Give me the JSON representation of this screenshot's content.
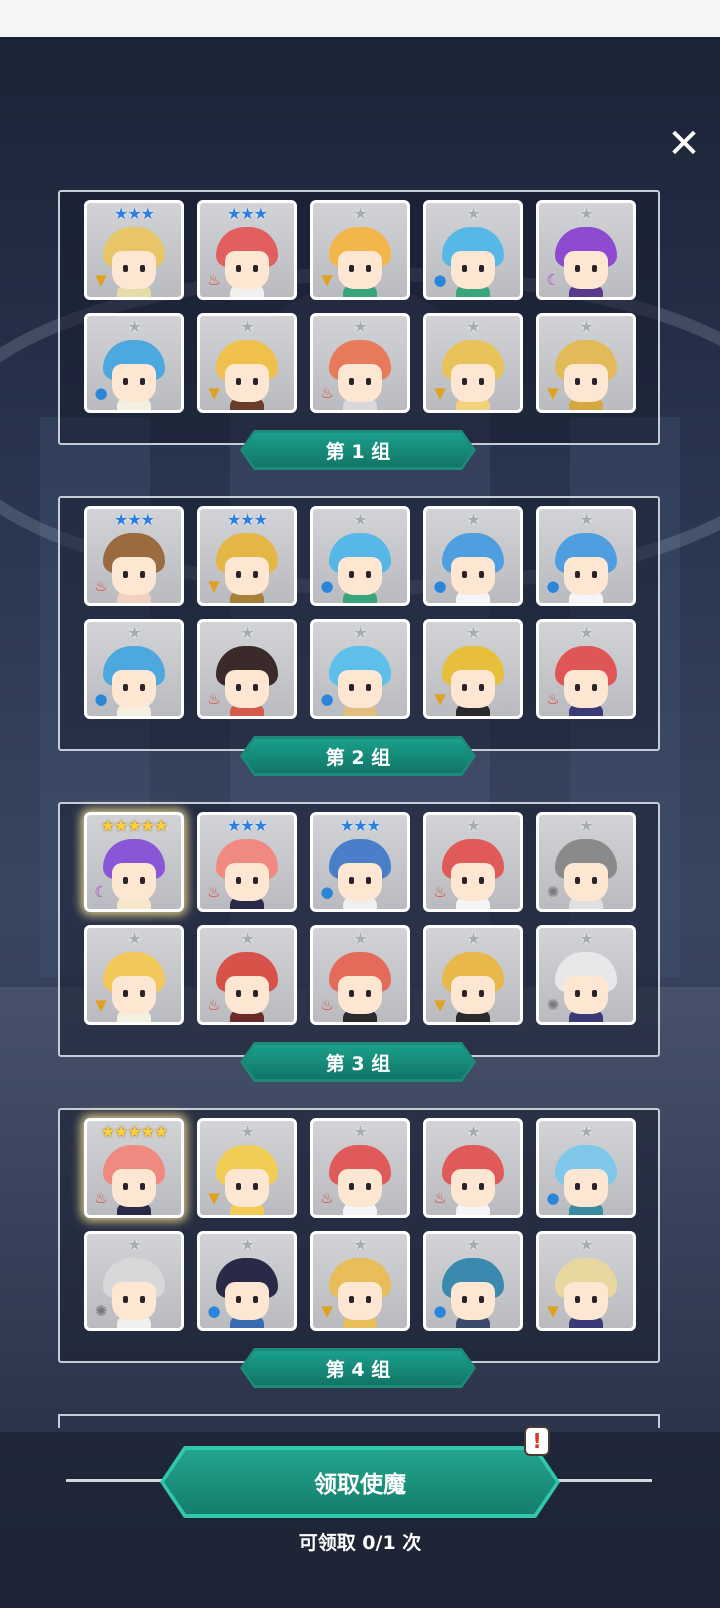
{
  "close_label": "✕",
  "groups": [
    {
      "label": "第 1 组",
      "cards": [
        {
          "stars": "★★★",
          "tier": "blue",
          "elem": "earth",
          "hair": "#e8c668",
          "body": "#e6dca8"
        },
        {
          "stars": "★★★",
          "tier": "blue",
          "elem": "fire",
          "hair": "#e25f5f",
          "body": "#f0f0f0"
        },
        {
          "stars": "★",
          "tier": "gray",
          "elem": "earth",
          "hair": "#f2b64a",
          "body": "#3aa57a"
        },
        {
          "stars": "★",
          "tier": "gray",
          "elem": "water",
          "hair": "#56b8e6",
          "body": "#3aa57a"
        },
        {
          "stars": "★",
          "tier": "gray",
          "elem": "dark",
          "hair": "#8e4ad0",
          "body": "#5a3a8a"
        },
        {
          "stars": "★",
          "tier": "gray",
          "elem": "water",
          "hair": "#4ea8e0",
          "body": "#f3f0e0"
        },
        {
          "stars": "★",
          "tier": "gray",
          "elem": "earth",
          "hair": "#efc04b",
          "body": "#6a3a2a"
        },
        {
          "stars": "★",
          "tier": "gray",
          "elem": "fire",
          "hair": "#e77a5a",
          "body": "#d8d8dc"
        },
        {
          "stars": "★",
          "tier": "gray",
          "elem": "earth",
          "hair": "#e8c35a",
          "body": "#f2d27a"
        },
        {
          "stars": "★",
          "tier": "gray",
          "elem": "earth",
          "hair": "#e2bb58",
          "body": "#d6a842"
        }
      ]
    },
    {
      "label": "第 2 组",
      "cards": [
        {
          "stars": "★★★",
          "tier": "blue",
          "elem": "fire",
          "hair": "#9a6a40",
          "body": "#f2d0c0"
        },
        {
          "stars": "★★★",
          "tier": "blue",
          "elem": "earth",
          "hair": "#e3b645",
          "body": "#a7813a"
        },
        {
          "stars": "★",
          "tier": "gray",
          "elem": "water",
          "hair": "#56b8e6",
          "body": "#3aa57a"
        },
        {
          "stars": "★",
          "tier": "gray",
          "elem": "water",
          "hair": "#4f9fe0",
          "body": "#f5f5f5"
        },
        {
          "stars": "★",
          "tier": "gray",
          "elem": "water",
          "hair": "#4f9fe0",
          "body": "#f5f5f5"
        },
        {
          "stars": "★",
          "tier": "gray",
          "elem": "water",
          "hair": "#4ea8e0",
          "body": "#f3f0e0"
        },
        {
          "stars": "★",
          "tier": "gray",
          "elem": "fire",
          "hair": "#3a2a2a",
          "body": "#d45a4a"
        },
        {
          "stars": "★",
          "tier": "gray",
          "elem": "water",
          "hair": "#5ec0ea",
          "body": "#e0c080"
        },
        {
          "stars": "★",
          "tier": "gray",
          "elem": "earth",
          "hair": "#e8bf3a",
          "body": "#2a2a2a"
        },
        {
          "stars": "★",
          "tier": "gray",
          "elem": "fire",
          "hair": "#e05656",
          "body": "#3a3a78"
        }
      ]
    },
    {
      "label": "第 3 组",
      "cards": [
        {
          "stars": "★★★★★",
          "tier": "gold",
          "elem": "dark",
          "hair": "#8a56d8",
          "body": "#f4e8c8",
          "glow": true
        },
        {
          "stars": "★★★",
          "tier": "blue",
          "elem": "fire",
          "hair": "#f08a80",
          "body": "#2a2a48"
        },
        {
          "stars": "★★★",
          "tier": "blue",
          "elem": "water",
          "hair": "#4b7ec8",
          "body": "#f0f0f0"
        },
        {
          "stars": "★",
          "tier": "gray",
          "elem": "fire",
          "hair": "#e05a5a",
          "body": "#f5f5f5"
        },
        {
          "stars": "★",
          "tier": "gray",
          "elem": "light",
          "hair": "#8a8a8a",
          "body": "#e0e0e0"
        },
        {
          "stars": "★",
          "tier": "gray",
          "elem": "earth",
          "hair": "#f2c85a",
          "body": "#f3f0e0"
        },
        {
          "stars": "★",
          "tier": "gray",
          "elem": "fire",
          "hair": "#d8524a",
          "body": "#6a2a2a"
        },
        {
          "stars": "★",
          "tier": "gray",
          "elem": "fire",
          "hair": "#e46a5a",
          "body": "#2a2a2a"
        },
        {
          "stars": "★",
          "tier": "gray",
          "elem": "earth",
          "hair": "#e8b84a",
          "body": "#2a2a2a"
        },
        {
          "stars": "★",
          "tier": "gray",
          "elem": "light",
          "hair": "#e8e8ea",
          "body": "#3a3a78"
        }
      ]
    },
    {
      "label": "第 4 组",
      "cards": [
        {
          "stars": "★★★★★",
          "tier": "gold",
          "elem": "fire",
          "hair": "#f08a80",
          "body": "#2a2a48",
          "glow": true
        },
        {
          "stars": "★",
          "tier": "gray",
          "elem": "earth",
          "hair": "#f2cd55",
          "body": "#f2cd55"
        },
        {
          "stars": "★",
          "tier": "gray",
          "elem": "fire",
          "hair": "#e05a5a",
          "body": "#f5f5f5"
        },
        {
          "stars": "★",
          "tier": "gray",
          "elem": "fire",
          "hair": "#e05a5a",
          "body": "#f5f5f5"
        },
        {
          "stars": "★",
          "tier": "gray",
          "elem": "water",
          "hair": "#7fc8ea",
          "body": "#3a8aa0"
        },
        {
          "stars": "★",
          "tier": "gray",
          "elem": "light",
          "hair": "#d8d8d8",
          "body": "#f0f0f0"
        },
        {
          "stars": "★",
          "tier": "gray",
          "elem": "water",
          "hair": "#2a2a48",
          "body": "#3a6ab0"
        },
        {
          "stars": "★",
          "tier": "gray",
          "elem": "earth",
          "hair": "#e8be5a",
          "body": "#e8be5a"
        },
        {
          "stars": "★",
          "tier": "gray",
          "elem": "water",
          "hair": "#3a8ab0",
          "body": "#3a4a6a"
        },
        {
          "stars": "★",
          "tier": "gray",
          "elem": "earth",
          "hair": "#e8d8a0",
          "body": "#3a3a78"
        }
      ]
    }
  ],
  "element_icons": {
    "fire": {
      "glyph": "♨",
      "color": "#e0452e"
    },
    "water": {
      "glyph": "●",
      "color": "#2a86d8"
    },
    "earth": {
      "glyph": "▼",
      "color": "#e0a020"
    },
    "dark": {
      "glyph": "☾",
      "color": "#b040d0"
    },
    "light": {
      "glyph": "✺",
      "color": "#7a7a7a"
    }
  },
  "claim_button": {
    "label": "领取使魔"
  },
  "alert_badge": "!",
  "claim_count": "可领取 0/1 次",
  "colors": {
    "accent": "#1d8a7a",
    "button": "#24a58d"
  }
}
